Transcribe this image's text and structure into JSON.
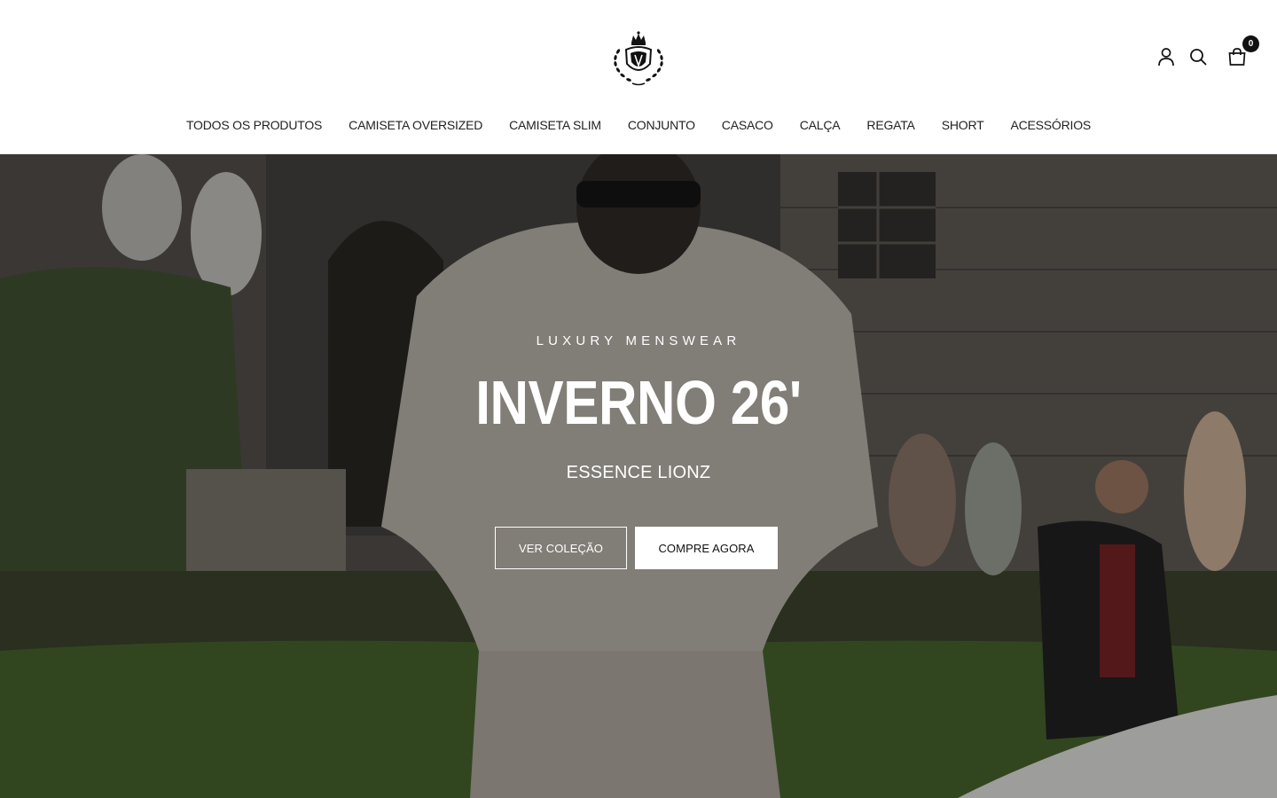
{
  "header": {
    "logo_name": "crown-laurel-crest-logo",
    "icons": {
      "account": "user-icon",
      "search": "search-icon",
      "cart": "shopping-bag-icon"
    },
    "cart_count": "0"
  },
  "nav": {
    "items": [
      {
        "label": "TODOS OS PRODUTOS"
      },
      {
        "label": "CAMISETA OVERSIZED"
      },
      {
        "label": "CAMISETA SLIM"
      },
      {
        "label": "CONJUNTO"
      },
      {
        "label": "CASACO"
      },
      {
        "label": "CALÇA"
      },
      {
        "label": "REGATA"
      },
      {
        "label": "SHORT"
      },
      {
        "label": "ACESSÓRIOS"
      }
    ]
  },
  "hero": {
    "eyebrow": "LUXURY MENSWEAR",
    "headline": "INVERNO 26'",
    "subtitle": "ESSENCE LIONZ",
    "primary_button": "VER COLEÇÃO",
    "secondary_button": "COMPRE AGORA"
  },
  "colors": {
    "header_bg": "#ffffff",
    "text": "#111111",
    "hero_text": "#ffffff",
    "button_solid_bg": "#ffffff"
  }
}
